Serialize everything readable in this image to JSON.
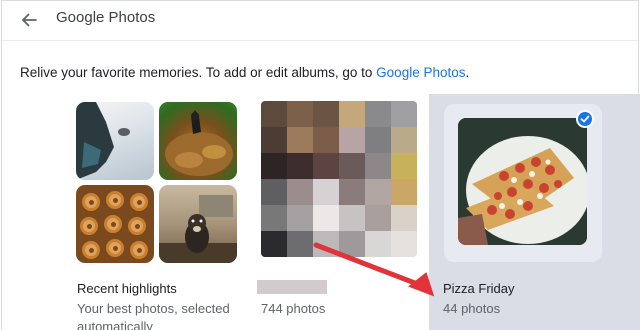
{
  "header": {
    "title": "Google Photos",
    "back_icon": "arrow-back-icon"
  },
  "intro": {
    "text": "Relive your favorite memories. To add or edit albums, go to ",
    "link": "Google Photos",
    "suffix": "."
  },
  "albums": [
    {
      "name": "Recent highlights",
      "subtitle_line1": "Your best photos, selected",
      "subtitle_line2": "automatically",
      "selected": false
    },
    {
      "name": "",
      "subtitle_line1": "744 photos",
      "selected": false
    },
    {
      "name": "Pizza Friday",
      "subtitle_line1": "44 photos",
      "selected": true,
      "check_icon": "checkmark-icon"
    }
  ],
  "colors": {
    "accent": "#1a73e8",
    "selected_bg": "#dadce6",
    "annotation_arrow": "#e2333b"
  }
}
